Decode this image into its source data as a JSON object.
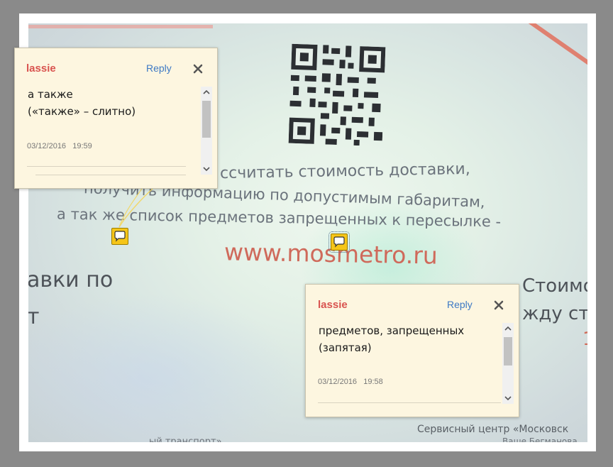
{
  "photo": {
    "lines": {
      "l1": "ссчитать стоимость доставки,",
      "l2": "получить информацию по допустимым габаритам,",
      "l3": "а так же список предметов запрещенных к пересылке -",
      "url": "www.mosmetro.ru",
      "l4": "авки по",
      "l5": "т",
      "l6": "Стоимо",
      "l7": "жду ста",
      "l8": "1",
      "l9": "Сервисный центр «Московск",
      "l10": "Ваше Бегманова",
      "l11": "ый транспорт»"
    }
  },
  "comments": [
    {
      "author": "lassie",
      "reply_label": "Reply",
      "close_icon": "close-icon",
      "text_line1": "а также",
      "text_line2": "(«также» – слитно)",
      "date": "03/12/2016",
      "time": "19:59"
    },
    {
      "author": "lassie",
      "reply_label": "Reply",
      "close_icon": "close-icon",
      "text_line1": "предметов, запрещенных",
      "text_line2": "(запятая)",
      "date": "03/12/2016",
      "time": "19:58"
    }
  ],
  "colors": {
    "author": "#d9534f",
    "reply": "#3d79c4",
    "note_icon": "#f5c518",
    "comment_bg": "#fdf6e0"
  }
}
